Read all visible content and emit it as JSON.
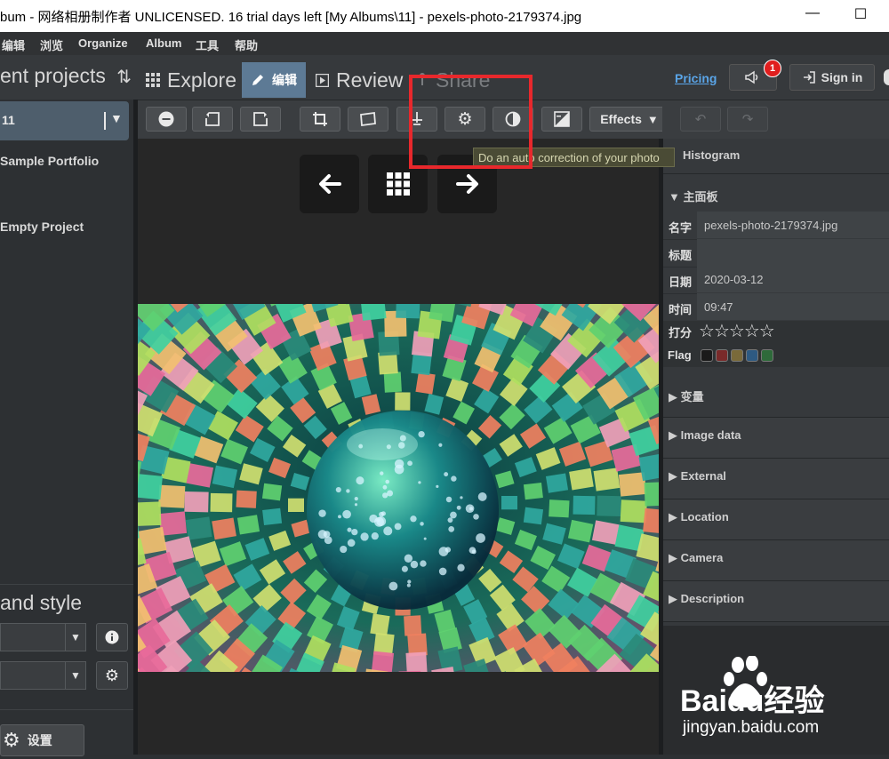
{
  "window": {
    "title": "bum - 网络相册制作者 UNLICENSED. 16 trial days left [My Albums\\11] - pexels-photo-2179374.jpg",
    "minimize_glyph": "—",
    "maximize_glyph": "☐"
  },
  "menu": [
    "编辑",
    "浏览",
    "Organize",
    "Album",
    "工具",
    "帮助"
  ],
  "left": {
    "header": "ent projects",
    "project_selected": "11",
    "projects": [
      "Sample Portfolio",
      "Empty Project"
    ],
    "section2_header": "and style",
    "select1_value": "",
    "select2_value": "",
    "settings_label": "设置"
  },
  "tabs": [
    {
      "label": "Explore",
      "icon": "grid-icon"
    },
    {
      "label": "编辑",
      "icon": "pencil-icon"
    },
    {
      "label": "Review",
      "icon": "play-icon"
    },
    {
      "label": "Share",
      "icon": "share-icon"
    }
  ],
  "topright": {
    "pricing": "Pricing",
    "notifications": "1",
    "signin": "Sign in"
  },
  "toolbar": {
    "effects": "Effects"
  },
  "tooltip": "Do an auto correction of your photo",
  "panel": {
    "histogram": "Histogram",
    "main_panel": "主面板",
    "fields": [
      {
        "label": "名字",
        "value": "pexels-photo-2179374.jpg"
      },
      {
        "label": "标题",
        "value": ""
      },
      {
        "label": "日期",
        "value": "2020-03-12"
      },
      {
        "label": "时间",
        "value": "09:47"
      }
    ],
    "rating_label": "打分",
    "rating_value": 0,
    "flag_label": "Flag",
    "flag_colors": [
      "#1a1a1a",
      "#7a2a2a",
      "#7a6a3a",
      "#2e5a82",
      "#2e6a3a"
    ],
    "sections": [
      "变量",
      "Image data",
      "External",
      "Location",
      "Camera",
      "Description"
    ]
  },
  "watermark": {
    "brand": "Baidu经验",
    "url": "jingyan.baidu.com"
  }
}
